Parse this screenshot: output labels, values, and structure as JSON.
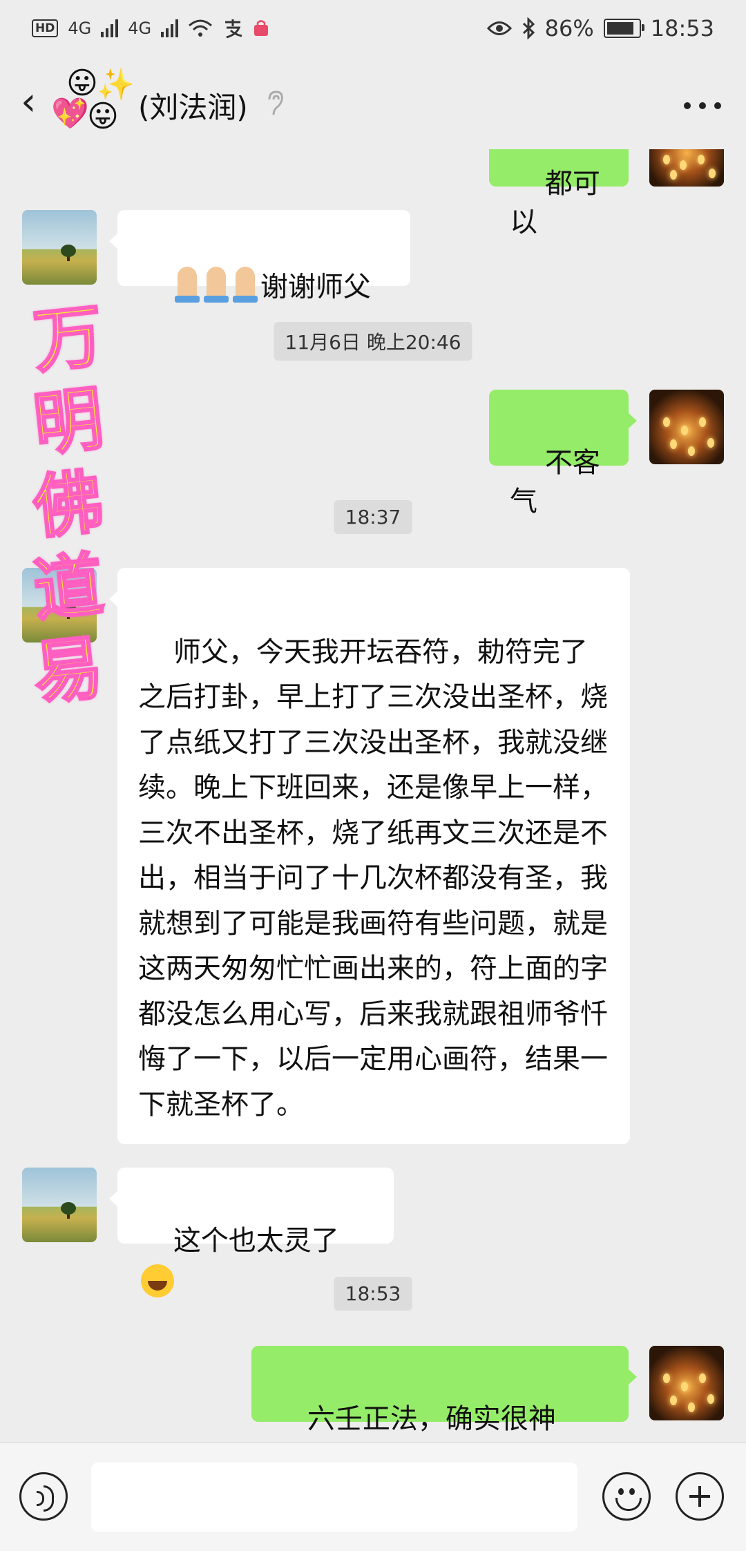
{
  "status_bar": {
    "hd_label": "HD",
    "sim1_label": "4G",
    "sim2_label": "4G",
    "battery_percent": "86%",
    "battery_level": 0.86,
    "time": "18:53"
  },
  "header": {
    "title": "(刘法润)",
    "sticker_emojis": [
      "😛",
      "💖",
      "😛",
      "✨"
    ]
  },
  "watermark": [
    "万",
    "明",
    "佛",
    "道",
    "易"
  ],
  "messages": {
    "m0": {
      "direction": "out",
      "text": "都可以"
    },
    "m1": {
      "direction": "in",
      "text": "谢谢师父",
      "prefix_icon": "praying-hands-emoji-x3"
    },
    "t1": "11月6日 晚上20:46",
    "m2": {
      "direction": "out",
      "text": "不客气"
    },
    "t2": "18:37",
    "m3": {
      "direction": "in",
      "text": "师父，今天我开坛吞符，勅符完了之后打卦，早上打了三次没出圣杯，烧了点纸又打了三次没出圣杯，我就没继续。晚上下班回来，还是像早上一样，三次不出圣杯，烧了纸再文三次还是不出，相当于问了十几次杯都没有圣，我就想到了可能是我画符有些问题，就是这两天匆匆忙忙画出来的，符上面的字都没怎么用心写，后来我就跟祖师爷忏悔了一下，以后一定用心画符，结果一下就圣杯了。"
    },
    "m4": {
      "direction": "in",
      "text": "这个也太灵了",
      "suffix_icon": "laughing-tears-emoji"
    },
    "t3": "18:53",
    "m5": {
      "direction": "out",
      "text": "六壬正法，确实很神奇。"
    }
  },
  "input_bar": {
    "placeholder": "",
    "icons": [
      "voice-icon",
      "emoji-icon",
      "plus-icon"
    ]
  }
}
